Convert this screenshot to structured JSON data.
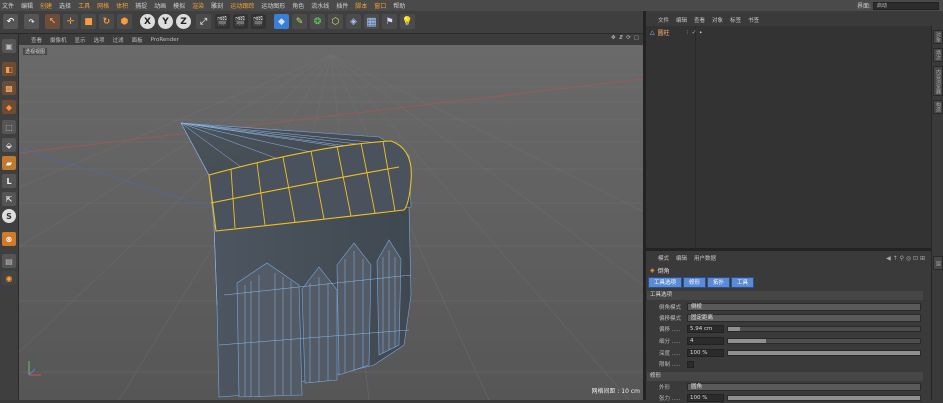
{
  "menubar": {
    "items": [
      "文件",
      "编辑",
      "创建",
      "选择",
      "工具",
      "网格",
      "体积",
      "捕捉",
      "动画",
      "模拟",
      "渲染",
      "雕刻",
      "运动跟踪",
      "运动图形",
      "角色",
      "流水线",
      "插件",
      "脚本",
      "窗口",
      "帮助"
    ],
    "layout_label": "界面:",
    "layout_value": "启动"
  },
  "toolbar": {
    "undo_icon": "undo-arrow-icon",
    "axis_x": "X",
    "axis_y": "Y",
    "axis_z": "Z"
  },
  "viewport": {
    "menu": [
      "查看",
      "摄像机",
      "显示",
      "选项",
      "过滤",
      "面板",
      "ProRender"
    ],
    "camera_label": "透视视图",
    "grid_info": "网格间距 : 10 cm"
  },
  "object_manager": {
    "menu": [
      "文件",
      "编辑",
      "查看",
      "对象",
      "标签",
      "书签"
    ],
    "object_name": "圆柱"
  },
  "right_tabs": [
    "对象",
    "场次",
    "内容浏览器",
    "构造",
    "层"
  ],
  "attribute_manager": {
    "menu": [
      "模式",
      "编辑",
      "用户数据"
    ],
    "title": "倒角",
    "tabs": [
      "工具选项",
      "修形",
      "拓扑",
      "工具"
    ],
    "section_tool_options": "工具选项",
    "section_shaping": "修形",
    "params": [
      {
        "label": "倒角模式",
        "value": "倒棱",
        "type": "dropdown"
      },
      {
        "label": "偏移模式",
        "value": "固定距离",
        "type": "dropdown"
      },
      {
        "label": "偏移 .....",
        "value": "5.94 cm",
        "type": "slider",
        "fill": 0.06
      },
      {
        "label": "细分 .....",
        "value": "4",
        "type": "slider",
        "fill": 0.2
      },
      {
        "label": "深度 .....",
        "value": "100 %",
        "type": "slider",
        "fill": 1.0
      },
      {
        "label": "限制 .....",
        "value": "",
        "type": "check"
      }
    ],
    "shaping_params": [
      {
        "label": "外形",
        "value": "圆角",
        "type": "dropdown"
      },
      {
        "label": "张力 .....",
        "value": "100 %",
        "type": "slider",
        "fill": 1.0
      }
    ]
  }
}
